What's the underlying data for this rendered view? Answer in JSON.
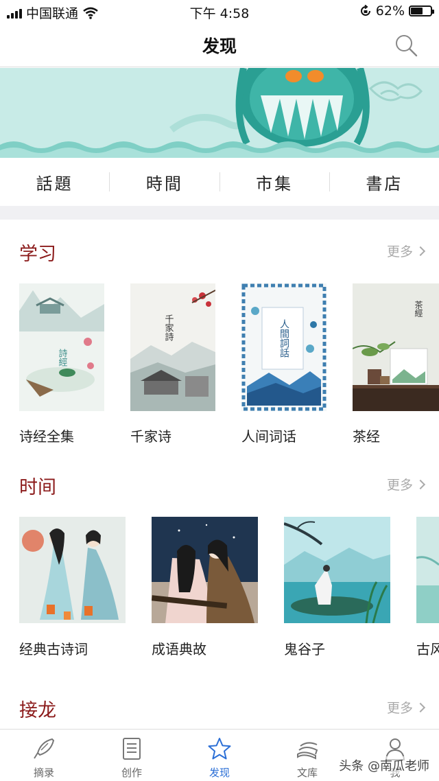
{
  "status_bar": {
    "carrier": "中国联通",
    "time": "下午 4:58",
    "battery": "62%",
    "battery_level": 0.62
  },
  "nav": {
    "title": "发现",
    "search_icon": "search-icon"
  },
  "categories": [
    "話題",
    "時間",
    "市集",
    "書店"
  ],
  "sections": [
    {
      "title": "学习",
      "more": "更多",
      "items": [
        {
          "label": "诗经全集",
          "cover_text": "詩經"
        },
        {
          "label": "千家诗",
          "cover_text": "千家詩"
        },
        {
          "label": "人间词话",
          "cover_text": "人間詞話"
        },
        {
          "label": "茶经",
          "cover_text": "茶經"
        }
      ]
    },
    {
      "title": "时间",
      "more": "更多",
      "items": [
        {
          "label": "经典古诗词"
        },
        {
          "label": "成语典故"
        },
        {
          "label": "鬼谷子"
        },
        {
          "label": "古风"
        }
      ]
    },
    {
      "title": "接龙",
      "more": "更多"
    }
  ],
  "tab_bar": [
    {
      "label": "摘录",
      "icon": "quill-pen-icon"
    },
    {
      "label": "创作",
      "icon": "document-icon"
    },
    {
      "label": "发现",
      "icon": "star-icon",
      "active": true
    },
    {
      "label": "文库",
      "icon": "books-icon"
    },
    {
      "label": "我",
      "icon": "person-icon"
    }
  ],
  "watermark": "头条 @南瓜老师",
  "colors": {
    "section_title": "#8b1a1a",
    "active_tab": "#2b6fd6",
    "banner": "#c6eae6"
  }
}
